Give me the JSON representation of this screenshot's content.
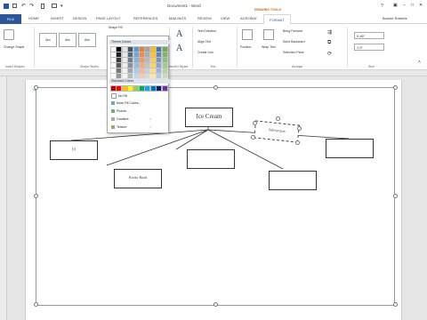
{
  "window": {
    "title": "Document1 - Word",
    "user": "Bonnie Roberts"
  },
  "contextual": {
    "label": "DRAWING TOOLS"
  },
  "tabs": [
    {
      "label": "FILE"
    },
    {
      "label": "HOME"
    },
    {
      "label": "INSERT"
    },
    {
      "label": "DESIGN"
    },
    {
      "label": "PAGE LAYOUT"
    },
    {
      "label": "REFERENCES"
    },
    {
      "label": "MAILINGS"
    },
    {
      "label": "REVIEW"
    },
    {
      "label": "VIEW"
    },
    {
      "label": "ACROBAT"
    },
    {
      "label": "FORMAT"
    }
  ],
  "ribbon": {
    "insert_shapes": {
      "change_label": "Change Shape",
      "group_label": "Insert Shapes"
    },
    "shape_styles": {
      "group_label": "Shape Styles",
      "styles": [
        "Abc",
        "Abc",
        "Abc"
      ],
      "fill_button": "Shape Fill"
    },
    "wordart": {
      "group_label": "WordArt Styles"
    },
    "text": {
      "direction": "Text Direction",
      "align": "Align Text",
      "link": "Create Link",
      "group_label": "Text"
    },
    "arrange": {
      "position": "Position",
      "wrap": "Wrap Text",
      "forward": "Bring Forward",
      "backward": "Send Backward",
      "pane": "Selection Pane",
      "group_label": "Arrange"
    },
    "size": {
      "height": "0.46\"",
      "width": "1.9\"",
      "group_label": "Size"
    }
  },
  "fill_menu": {
    "theme_header": "Theme Colors",
    "standard_header": "Standard Colors",
    "theme_colors": [
      "#ffffff",
      "#000000",
      "#e7e6e6",
      "#44546a",
      "#5b9bd5",
      "#ed7d31",
      "#a5a5a5",
      "#ffc000",
      "#4472c4",
      "#70ad47"
    ],
    "standard_colors": [
      "#c00000",
      "#ff0000",
      "#ffc000",
      "#ffff00",
      "#92d050",
      "#00b050",
      "#00b0f0",
      "#0070c0",
      "#002060",
      "#7030a0"
    ],
    "items": [
      {
        "label": "No Fill"
      },
      {
        "label": "More Fill Colors..."
      },
      {
        "label": "Picture..."
      },
      {
        "label": "Gradient"
      },
      {
        "label": "Texture"
      }
    ]
  },
  "diagram": {
    "root": "Ice Cream",
    "child1": "[t]",
    "child2": "",
    "child3": "",
    "child4": "",
    "selected_text": "Sub-section",
    "grandchild": "Rocky Road"
  }
}
